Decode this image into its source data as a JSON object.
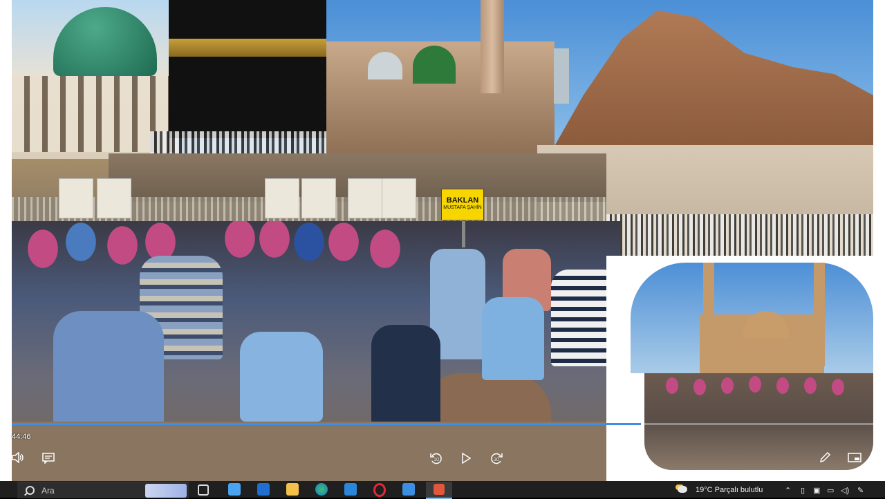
{
  "player": {
    "current_time": "44:46",
    "progress_fraction": 0.73,
    "skip_back_seconds": "10",
    "skip_forward_seconds": "30"
  },
  "video": {
    "sign_line1": "BAKLAN",
    "sign_line2": "MUSTAFA ŞAHİN"
  },
  "taskbar": {
    "search_placeholder": "Ara",
    "weather": "19°C  Parçalı bulutlu",
    "icons": [
      "task-view-icon",
      "widgets-icon",
      "mail-icon",
      "file-explorer-icon",
      "edge-icon",
      "store-icon",
      "opera-icon",
      "app-icon",
      "video-player-icon"
    ]
  },
  "colors": {
    "progress": "#3d8fe4",
    "taskbar": "#1f1f1f"
  }
}
